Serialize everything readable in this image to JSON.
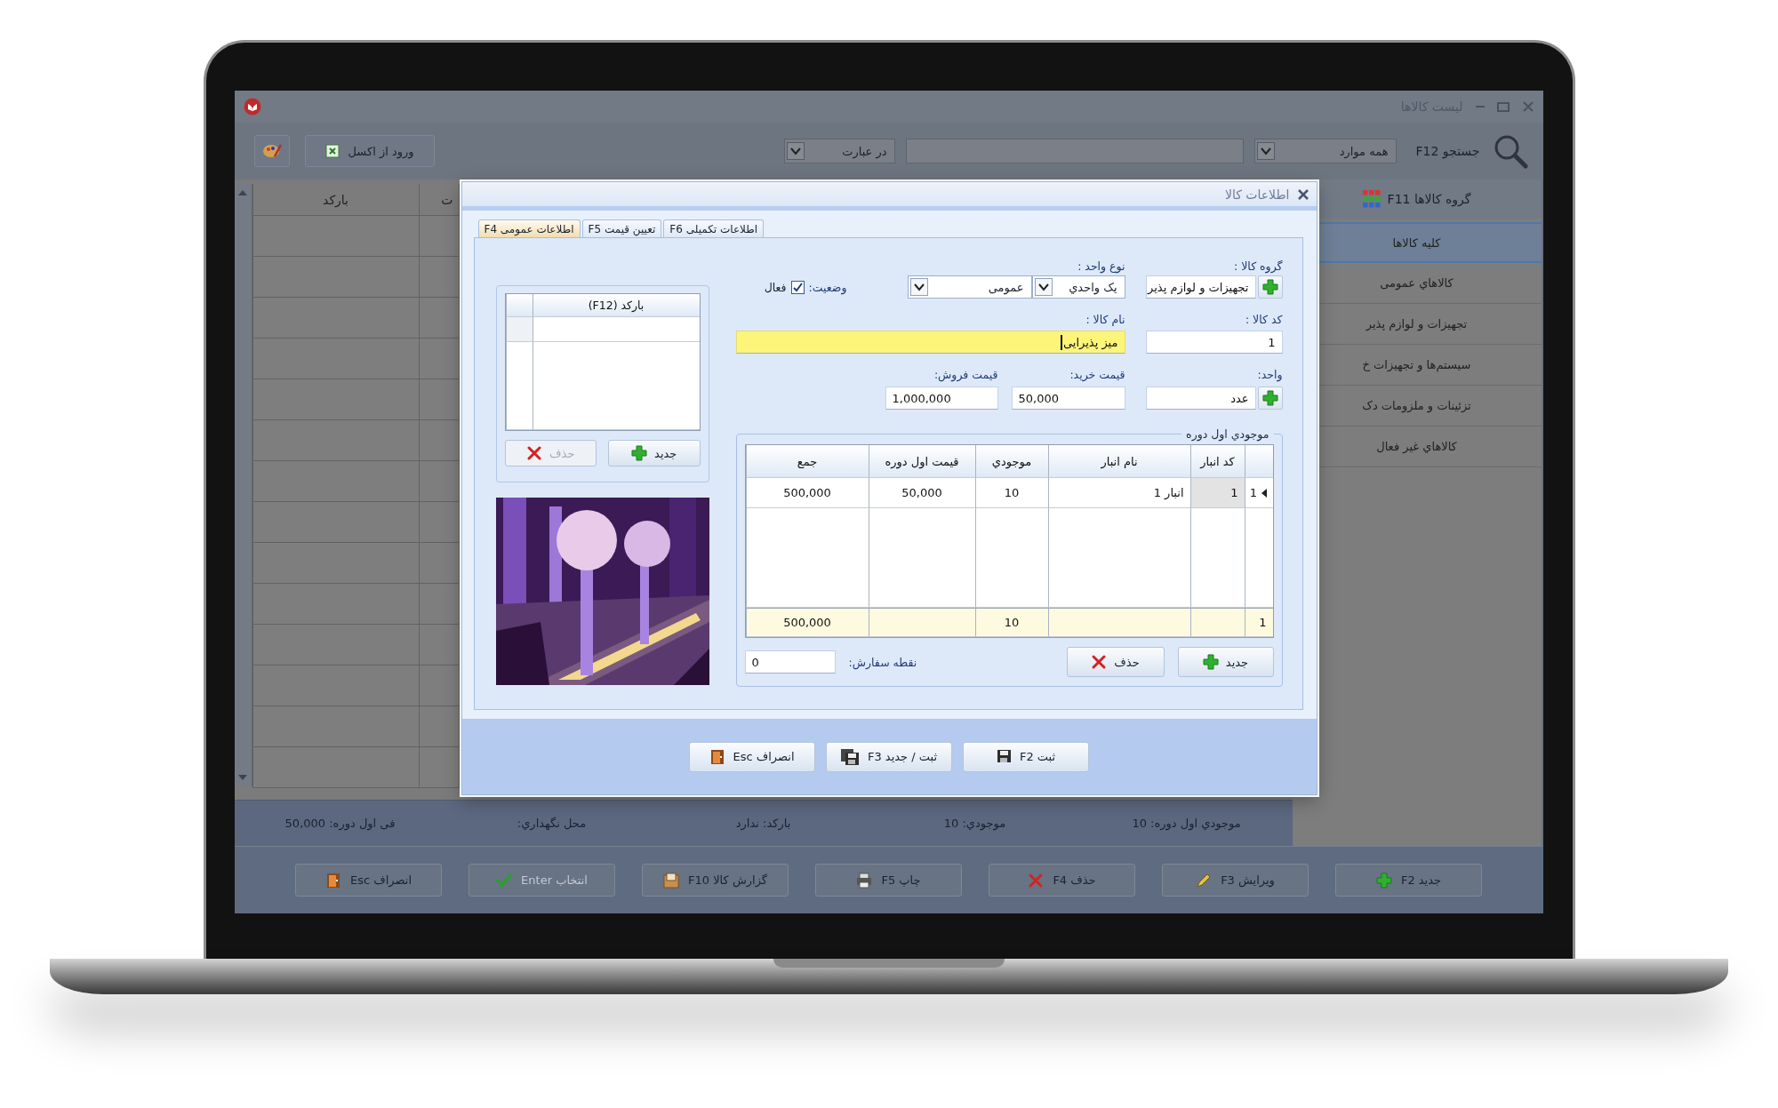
{
  "window": {
    "title": "لیست کالاها"
  },
  "toolbar": {
    "search_label": "جستجو F12",
    "scope_dropdown": "همه موارد",
    "match_dropdown": "در عبارت",
    "import_button": "ورود از اکسل"
  },
  "sidebar": {
    "title": "گروه کالاها F11",
    "items": [
      {
        "label": "کلیه کالاها",
        "selected": true
      },
      {
        "label": "کالاهاي عمومی",
        "selected": false
      },
      {
        "label": "تجهیزات و لوازم پذیر",
        "selected": false
      },
      {
        "label": "سیستم‌ها و تجهیزات خ",
        "selected": false
      },
      {
        "label": "تزئینات و ملزومات دک",
        "selected": false
      },
      {
        "label": "کالاهاي غیر فعال",
        "selected": false
      }
    ]
  },
  "grid": {
    "columns": [
      "ت",
      "بارکد"
    ]
  },
  "status_bar": [
    "موجودي اول دوره: 10",
    "موجودي: 10",
    "بارکد: ندارد",
    "محل نگهداري:",
    "فی اول دوره: 50,000"
  ],
  "actions": [
    {
      "label": "جدید F2",
      "kind": "new",
      "disabled": false
    },
    {
      "label": "ویرایش F3",
      "kind": "edit",
      "disabled": false
    },
    {
      "label": "حذف F4",
      "kind": "delete",
      "disabled": false
    },
    {
      "label": "چاپ F5",
      "kind": "print",
      "disabled": false
    },
    {
      "label": "گزارش کالا F10",
      "kind": "report",
      "disabled": false
    },
    {
      "label": "انتخاب Enter",
      "kind": "select",
      "disabled": true
    },
    {
      "label": "انصراف Esc",
      "kind": "cancel",
      "disabled": false
    }
  ],
  "dialog": {
    "title": "اطلاعات کالا",
    "tabs": [
      {
        "label": "اطلاعات تکمیلی F6",
        "selected": false
      },
      {
        "label": "تعیین قیمت F5",
        "selected": false
      },
      {
        "label": "اطلاعات عمومی F4",
        "selected": true
      }
    ],
    "group": {
      "label": "گروه کالا :",
      "value": "تجهیزات و لوازم پذیر"
    },
    "unit_type": {
      "label": "نوع واحد :",
      "values": [
        "یک واحدي",
        "عمومی"
      ]
    },
    "status": {
      "label": "وضعیت:",
      "option": "فعال",
      "checked": true
    },
    "code": {
      "label": "کد کالا :",
      "value": "1"
    },
    "name": {
      "label": "نام کالا :",
      "value": "میز پذیرایی"
    },
    "unit": {
      "label": "واحد:",
      "value": "عدد"
    },
    "purchase_price": {
      "label": "قیمت خرید:",
      "value": "50,000"
    },
    "sale_price": {
      "label": "قیمت فروش:",
      "value": "1,000,000"
    },
    "opening_stock": {
      "title": "موجودي اول دوره",
      "columns": [
        "کد انبار",
        "نام انبار",
        "موجودي",
        "قیمت اول دوره",
        "جمع"
      ],
      "rows": [
        {
          "index": "1",
          "selected": true,
          "cells": [
            "1",
            "انبار 1",
            "10",
            "50,000",
            "500,000"
          ]
        }
      ],
      "footer": {
        "index": "1",
        "stock": "10",
        "total": "500,000"
      },
      "buttons": [
        {
          "label": "جدید",
          "kind": "new"
        },
        {
          "label": "حذف",
          "kind": "delete"
        }
      ]
    },
    "reorder_point": {
      "label": "نقطه سفارش:",
      "value": "0"
    },
    "barcodes": {
      "column": "بارکد (F12)",
      "buttons": [
        {
          "label": "جدید",
          "kind": "new",
          "disabled": false
        },
        {
          "label": "حذف",
          "kind": "delete",
          "disabled": true
        }
      ]
    },
    "buttons": [
      {
        "label": "ثبت F2",
        "kind": "save"
      },
      {
        "label": "ثبت / جدید F3",
        "kind": "save_new"
      },
      {
        "label": "انصراف Esc",
        "kind": "cancel"
      }
    ]
  }
}
